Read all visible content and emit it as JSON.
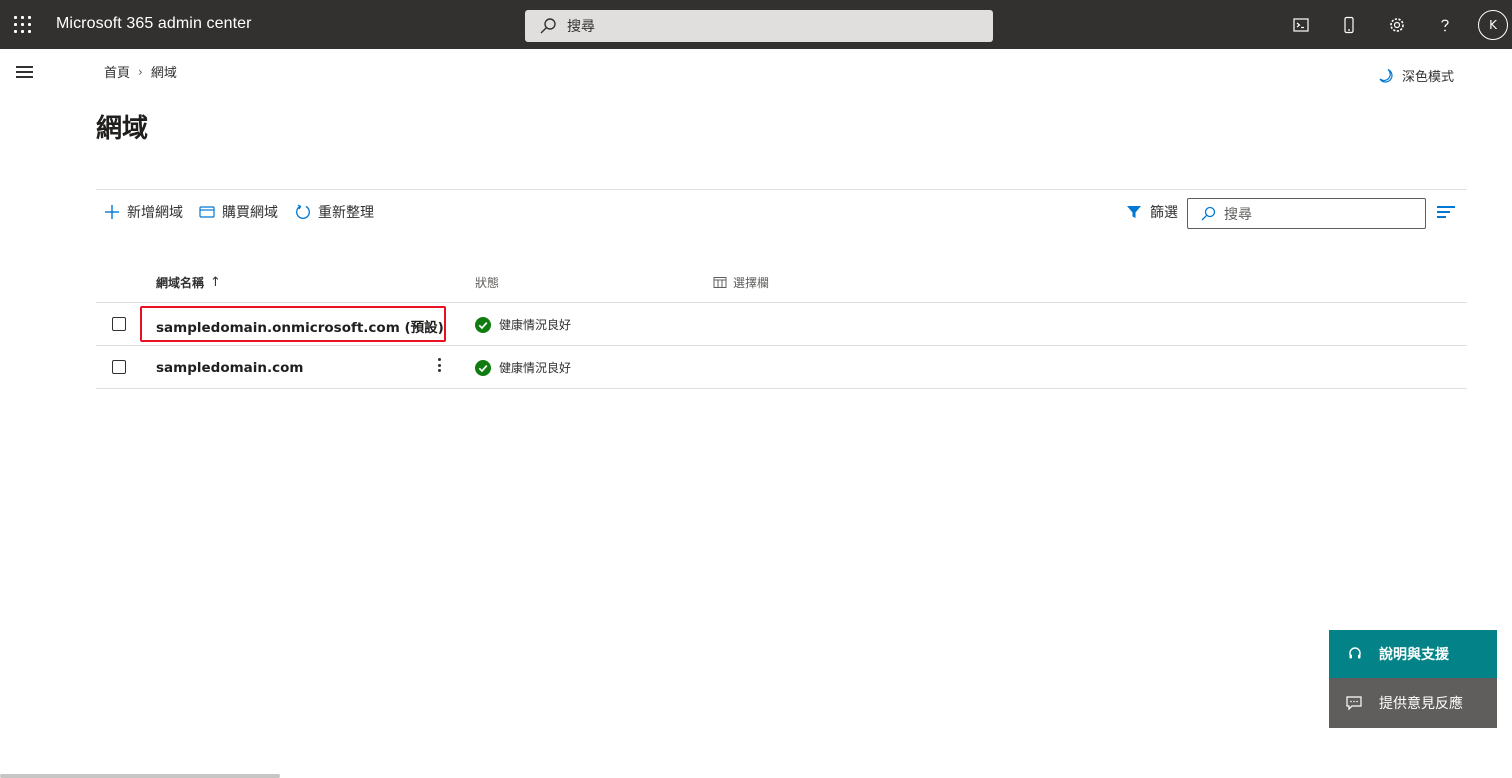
{
  "topbar": {
    "app_title": "Microsoft 365 admin center",
    "search_placeholder": "搜尋",
    "avatar_initial": "K",
    "icons": [
      "waffle-icon",
      "search-icon",
      "terminal-icon",
      "mobile-icon",
      "gear-icon",
      "help-icon"
    ]
  },
  "breadcrumb": {
    "home": "首頁",
    "current": "網域"
  },
  "dark_mode_label": "深色模式",
  "page_title": "網域",
  "commands": {
    "add_domain": "新增網域",
    "buy_domain": "購買網域",
    "refresh": "重新整理",
    "filter": "篩選",
    "search_placeholder": "搜尋"
  },
  "table": {
    "headers": {
      "name": "網域名稱",
      "sort_indicator": "↑",
      "status": "狀態",
      "choose_columns": "選擇欄"
    },
    "rows": [
      {
        "name": "sampledomain.onmicrosoft.com (預設)",
        "status": "健康情況良好",
        "highlighted": true
      },
      {
        "name": "sampledomain.com",
        "status": "健康情況良好",
        "highlighted": false
      }
    ]
  },
  "help": {
    "support_label": "說明與支援",
    "feedback_label": "提供意見反應"
  },
  "colors": {
    "topbar": "#323130",
    "accent": "#0078d4",
    "success": "#107c10",
    "help_teal": "#038387",
    "highlight_red": "#e81123"
  }
}
